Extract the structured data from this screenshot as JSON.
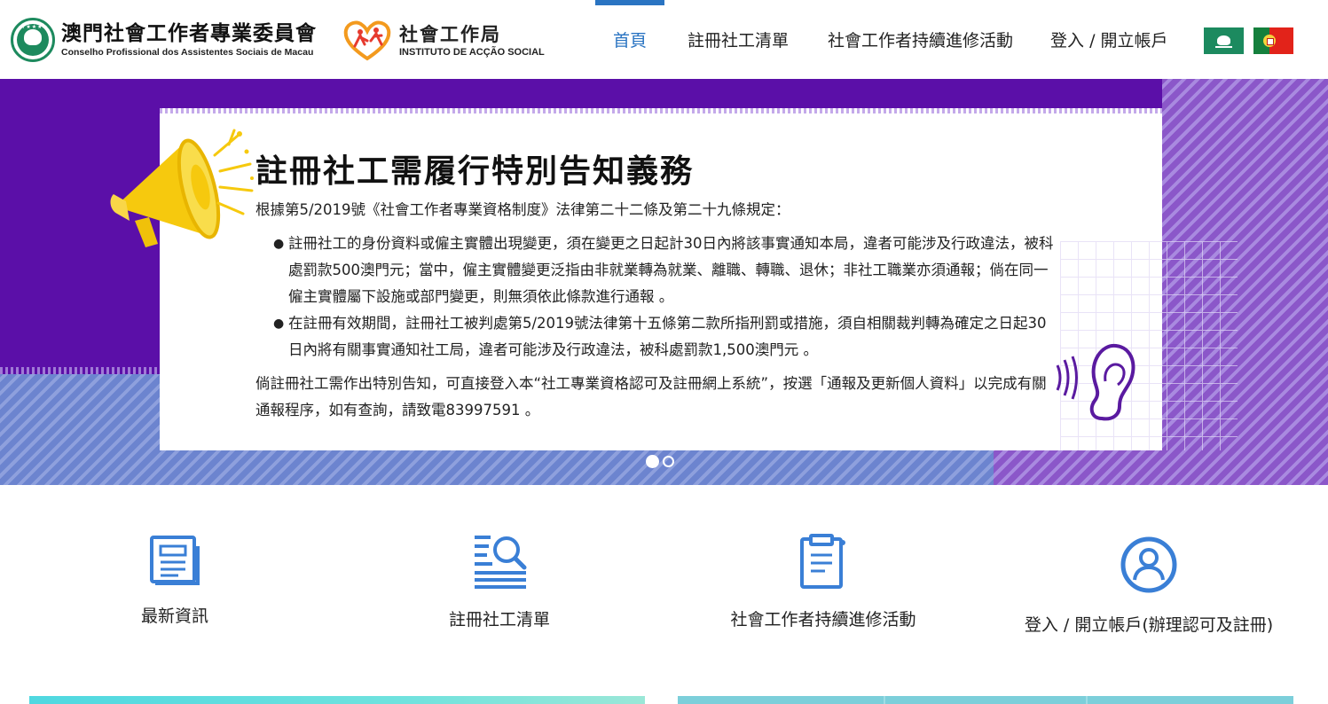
{
  "header": {
    "org_zh": "澳門社會工作者專業委員會",
    "org_pt": "Conselho Profissional dos Assistentes Sociais de Macau",
    "ias_zh": "社會工作局",
    "ias_pt": "INSTITUTO DE ACÇÃO SOCIAL"
  },
  "nav": {
    "items": [
      {
        "label": "首頁",
        "active": true
      },
      {
        "label": "註冊社工清單",
        "active": false
      },
      {
        "label": "社會工作者持續進修活動",
        "active": false
      },
      {
        "label": "登入 / 開立帳戶",
        "active": false
      }
    ],
    "accent_color": "#2a74c2"
  },
  "banner": {
    "title": "註冊社工需履行特別告知義務",
    "intro": "根據第5/2019號《社會工作者專業資格制度》法律第二十二條及第二十九條規定：",
    "bullets": [
      "註冊社工的身份資料或僱主實體出現變更，須在變更之日起計30日內將該事實通知本局，違者可能涉及行政違法，被科處罰款500澳門元；當中，僱主實體變更泛指由非就業轉為就業、離職、轉職、退休；非社工職業亦須通報；倘在同一僱主實體屬下設施或部門變更，則無須依此條款進行通報 。",
      "在註冊有效期間，註冊社工被判處第5/2019號法律第十五條第二款所指刑罰或措施，須自相關裁判轉為確定之日起30日內將有關事實通知社工局，違者可能涉及行政違法，被科處罰款1,500澳門元 。"
    ],
    "footer": "倘註冊社工需作出特別告知，可直接登入本“社工專業資格認可及註冊網上系統”，按選「通報及更新個人資料」以完成有關通報程序，如有查詢，請致電83997591 。",
    "slides": 2,
    "active_slide": 1
  },
  "quick_links": [
    {
      "label": "最新資訊",
      "icon": "news-icon"
    },
    {
      "label": "註冊社工清單",
      "icon": "list-search-icon"
    },
    {
      "label": "社會工作者持續進修活動",
      "icon": "clipboard-icon"
    },
    {
      "label": "登入 / 開立帳戶(辦理認可及註冊)",
      "icon": "user-icon"
    }
  ],
  "colors": {
    "icon_blue": "#3a7fd6",
    "banner_purple": "#5b0fa8"
  }
}
